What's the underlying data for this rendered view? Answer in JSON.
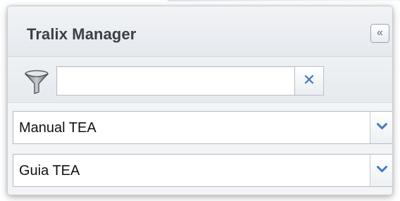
{
  "panel": {
    "title": "Tralix Manager",
    "collapse_glyph": "«"
  },
  "filter": {
    "icon": "funnel-icon",
    "value": "",
    "placeholder": "",
    "clear_glyph": "✕"
  },
  "combos": [
    {
      "value": "Manual TEA",
      "trigger_icon": "chevron-down-icon"
    },
    {
      "value": "Guia TEA",
      "trigger_icon": "chevron-down-icon"
    }
  ],
  "colors": {
    "accent": "#3f79c2",
    "title_text": "#3a4048",
    "header_bg": "#e9edf1",
    "border": "#b3bcc5"
  }
}
